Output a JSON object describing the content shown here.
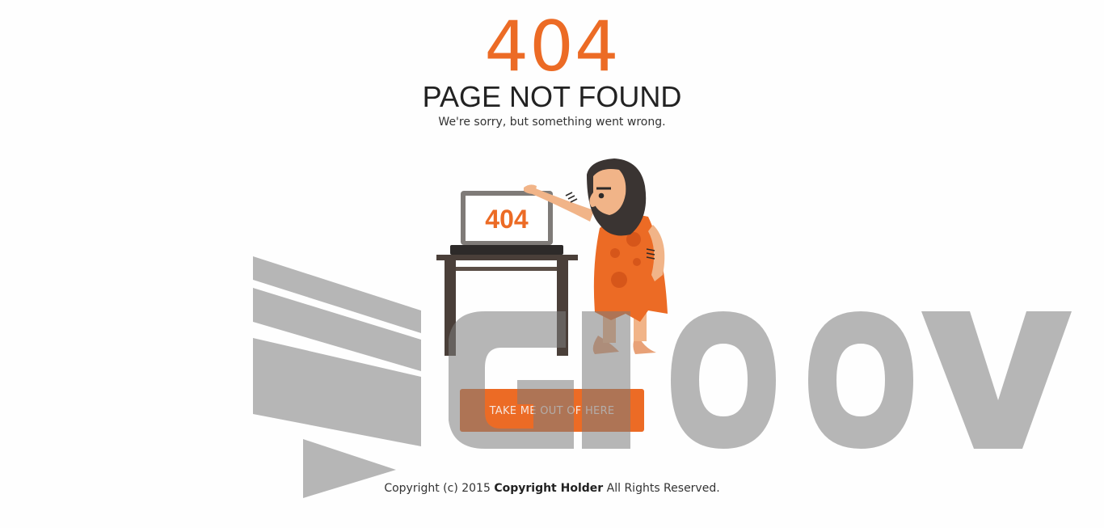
{
  "error": {
    "code": "404",
    "title": "PAGE NOT FOUND",
    "message": "We're sorry, but something went wrong."
  },
  "illustration": {
    "screen_text": "404"
  },
  "cta": {
    "label": "TAKE ME OUT OF HERE"
  },
  "footer": {
    "prefix": "Copyright (c) 2015",
    "holder": "Copyright Holder",
    "suffix": "All Rights Reserved."
  },
  "colors": {
    "accent": "#ec6b25",
    "text_dark": "#222222",
    "watermark": "#a0a0a0"
  },
  "watermark": {
    "text": "GIOOV"
  }
}
